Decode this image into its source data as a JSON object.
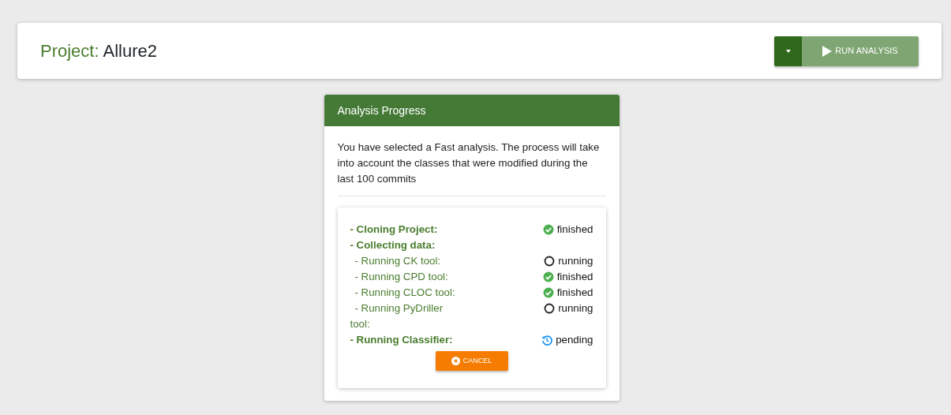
{
  "header": {
    "label": "Project:",
    "project": "Allure2",
    "run_button": "RUN ANALYSIS"
  },
  "progress": {
    "title": "Analysis Progress",
    "description": "You have selected a Fast analysis. The process will take into account the classes that were modified during the last 100 commits",
    "steps": [
      {
        "kind": "step",
        "label": "- Cloning Project:",
        "status": {
          "kind": "done",
          "text": "finished"
        }
      },
      {
        "kind": "step",
        "label": "- Collecting data:"
      },
      {
        "kind": "substep",
        "label": "- Running CK tool:",
        "status": {
          "kind": "active",
          "text": "running"
        }
      },
      {
        "kind": "substep",
        "label": "- Running CPD tool:",
        "status": {
          "kind": "done",
          "text": "finished"
        }
      },
      {
        "kind": "substep",
        "label": "- Running CLOC tool:",
        "status": {
          "kind": "done",
          "text": "finished"
        }
      },
      {
        "kind": "substep",
        "label": "- Running PyDriller tool:",
        "status": {
          "kind": "active",
          "text": "running"
        }
      },
      {
        "kind": "step",
        "label": "- Running Classifier:",
        "status": {
          "kind": "waiting",
          "text": "pending"
        }
      }
    ],
    "cancel_button": "CANCEL"
  }
}
